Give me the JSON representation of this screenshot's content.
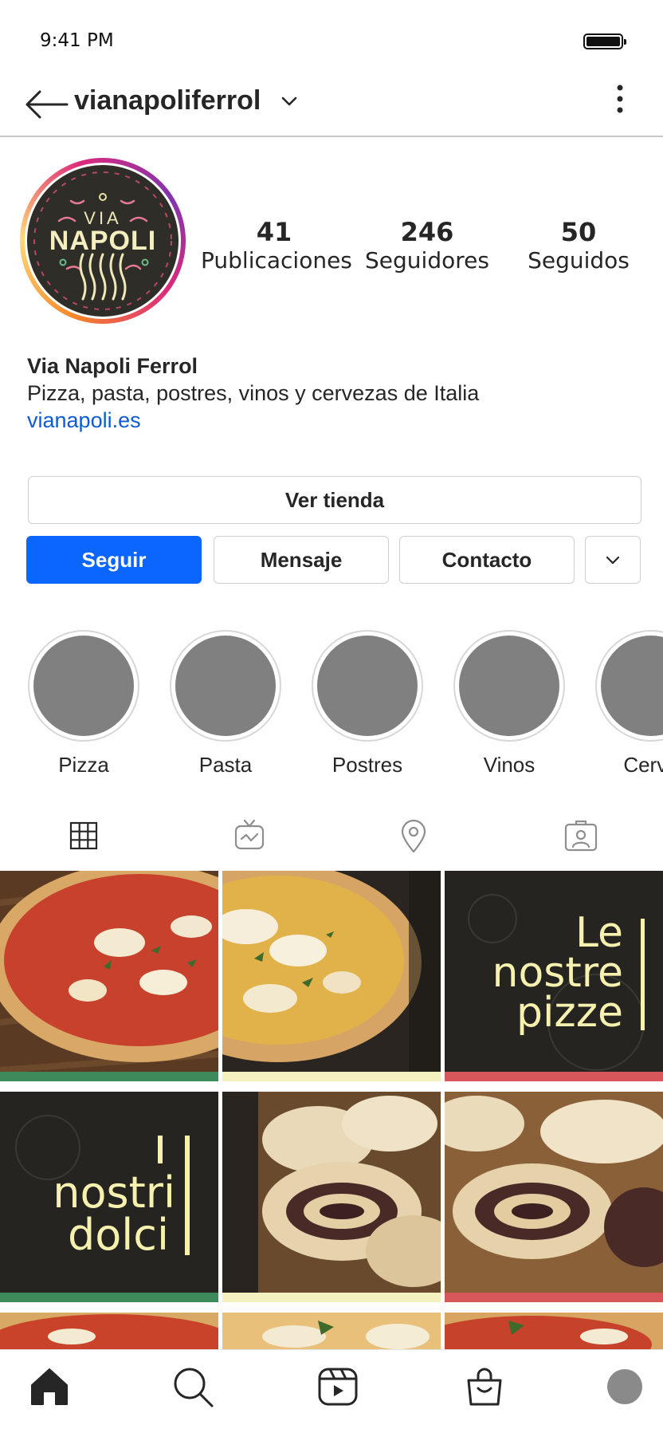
{
  "status_bar": {
    "time": "9:41 PM",
    "battery_level": 1.0
  },
  "header": {
    "username": "vianapoliferrol"
  },
  "profile": {
    "logo": {
      "line1": "VIA",
      "line2": "NAPOLI"
    },
    "stats": [
      {
        "value": "41",
        "label": "Publicaciones"
      },
      {
        "value": "246",
        "label": "Seguidores"
      },
      {
        "value": "50",
        "label": "Seguidos"
      }
    ],
    "display_name": "Via Napoli Ferrol",
    "bio": "Pizza, pasta, postres, vinos y cervezas de Italia",
    "link": "vianapoli.es"
  },
  "actions": {
    "shop": "Ver tienda",
    "follow": "Seguir",
    "message": "Mensaje",
    "contact": "Contacto"
  },
  "highlights": [
    {
      "label": "Pizza"
    },
    {
      "label": "Pasta"
    },
    {
      "label": "Postres"
    },
    {
      "label": "Vinos"
    },
    {
      "label": "Cerve"
    }
  ],
  "tabs": [
    {
      "icon": "grid-icon"
    },
    {
      "icon": "igtv-icon"
    },
    {
      "icon": "location-pin-icon"
    },
    {
      "icon": "tagged-icon"
    }
  ],
  "posts": {
    "pizze_line1": "Le",
    "pizze_line2": "nostre",
    "pizze_line3": "pizze",
    "dolci_line1": "nostri",
    "dolci_line2": "dolci"
  },
  "colors": {
    "accent_blue": "#0a66ff",
    "tile_dark": "#252420",
    "tile_text": "#f7f1b0",
    "stripe_green": "#3f8a5a",
    "stripe_cream": "#f4f0c0",
    "stripe_red": "#d8575a"
  },
  "bottom_nav": [
    {
      "icon": "home-icon"
    },
    {
      "icon": "search-icon"
    },
    {
      "icon": "reels-icon"
    },
    {
      "icon": "shop-icon"
    },
    {
      "icon": "profile-avatar"
    }
  ]
}
